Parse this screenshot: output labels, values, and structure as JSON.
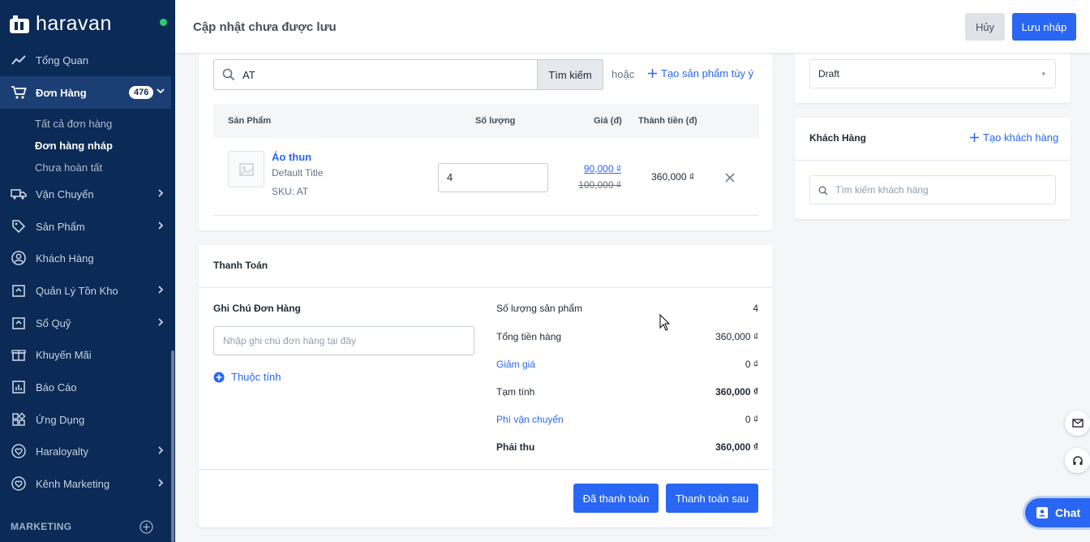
{
  "app": {
    "logo": "haravan"
  },
  "sidebar": {
    "items": [
      {
        "label": "Tổng Quan",
        "icon": "chart-line-icon"
      },
      {
        "label": "Đơn Hàng",
        "icon": "cart-icon",
        "badge": "476"
      },
      {
        "label": "Vận Chuyển",
        "icon": "truck-icon"
      },
      {
        "label": "Sản Phẩm",
        "icon": "tag-icon"
      },
      {
        "label": "Khách Hàng",
        "icon": "user-circle-icon"
      },
      {
        "label": "Quản Lý Tồn Kho",
        "icon": "inventory-icon"
      },
      {
        "label": "Sổ Quỹ",
        "icon": "cashbook-icon"
      },
      {
        "label": "Khuyến Mãi",
        "icon": "gift-icon"
      },
      {
        "label": "Báo Cáo",
        "icon": "report-icon"
      },
      {
        "label": "Ứng Dụng",
        "icon": "apps-icon"
      },
      {
        "label": "Haraloyalty",
        "icon": "heart-icon"
      },
      {
        "label": "Kênh Marketing",
        "icon": "heart-icon"
      }
    ],
    "sub_items": [
      {
        "label": "Tất cả đơn hàng"
      },
      {
        "label": "Đơn hàng nháp"
      },
      {
        "label": "Chưa hoàn tất"
      }
    ],
    "section_title": "MARKETING"
  },
  "header": {
    "title": "Cập nhật chưa được lưu",
    "cancel_label": "Hủy",
    "save_label": "Lưu nháp"
  },
  "products": {
    "search_value": "AT",
    "search_button": "Tìm kiếm",
    "or_text": "hoặc",
    "create_link": "Tạo sản phẩm tùy ý",
    "columns": [
      "Sản Phẩm",
      "Số lượng",
      "Giá (đ)",
      "Thành tiền (đ)"
    ],
    "rows": [
      {
        "name": "Áo thun",
        "variant": "Default Title",
        "sku": "SKU: AT",
        "quantity": "4",
        "price": "90,000 ₫",
        "compare_price": "100,000 ₫",
        "total": "360,000 ₫"
      }
    ]
  },
  "payment": {
    "title": "Thanh Toán",
    "note_label": "Ghi Chú Đơn Hàng",
    "note_placeholder": "Nhập ghi chú đơn hàng tại đây",
    "attributes_link": "Thuộc tính",
    "summary": [
      {
        "label": "Số lượng sản phẩm",
        "value": "4"
      },
      {
        "label": "Tổng tiền hàng",
        "value": "360,000 ₫"
      },
      {
        "label": "Giảm giá",
        "value": "0 ₫"
      },
      {
        "label": "Tạm tính",
        "value": "360,000 ₫"
      },
      {
        "label": "Phí vận chuyển",
        "value": "0 ₫"
      },
      {
        "label": "Phải thu",
        "value": "360,000 ₫"
      }
    ],
    "paid_button": "Đã thanh toán",
    "pay_later_button": "Thanh toán sau"
  },
  "status": {
    "value": "Draft"
  },
  "customer": {
    "title": "Khách Hàng",
    "create_link": "Tạo khách hàng",
    "search_placeholder": "Tìm kiếm khách hàng"
  },
  "chat": {
    "label": "Chat"
  },
  "colors": {
    "sidebar_bg": "#0b2a56",
    "accent": "#2a66f4",
    "online": "#2ecc71"
  }
}
